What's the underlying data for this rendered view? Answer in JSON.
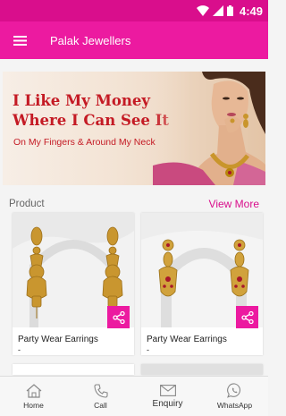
{
  "status": {
    "time": "4:49"
  },
  "app": {
    "title": "Palak Jewellers"
  },
  "banner": {
    "line1": "I Like My Money",
    "line2": "Where I Can See It",
    "sub": "On My Fingers & Around My Neck",
    "slide_count": 3,
    "active_slide": 2
  },
  "products": {
    "section_title": "Product",
    "view_more": "View More",
    "items": [
      {
        "name": "Party Wear Earrings",
        "price": "-"
      },
      {
        "name": "Party Wear Earrings",
        "price": "-"
      }
    ]
  },
  "nav": {
    "items": [
      {
        "label": "Home",
        "icon": "home-icon"
      },
      {
        "label": "Call",
        "icon": "phone-icon"
      },
      {
        "label": "Enquiry",
        "icon": "mail-icon"
      },
      {
        "label": "WhatsApp",
        "icon": "whatsapp-icon"
      }
    ]
  },
  "colors": {
    "primary": "#ec1aa0",
    "status_bar": "#d90e8c",
    "banner_text": "#c41a24"
  }
}
